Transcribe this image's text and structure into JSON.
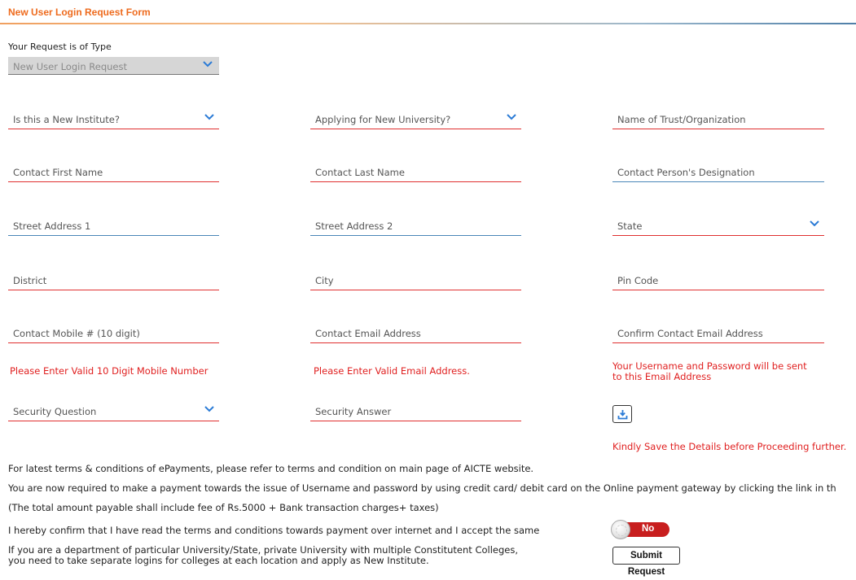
{
  "form": {
    "title": "New User Login Request Form",
    "request_type_label": "Your Request is of Type",
    "request_type_value": "New User Login Request"
  },
  "fields": {
    "new_institute": "Is this a New Institute?",
    "new_university": "Applying for New University?",
    "trust_name": "Name of Trust/Organization",
    "first_name": "Contact First Name",
    "last_name": "Contact Last Name",
    "designation": "Contact Person's Designation",
    "street1": "Street Address 1",
    "street2": "Street Address 2",
    "state": "State",
    "district": "District",
    "city": "City",
    "pin": "Pin Code",
    "mobile": "Contact Mobile # (10 digit)",
    "email": "Contact Email Address",
    "confirm_email": "Confirm Contact Email Address",
    "security_question": "Security Question",
    "security_answer": "Security Answer"
  },
  "messages": {
    "mobile_error": "Please Enter Valid 10 Digit Mobile Number",
    "email_error": "Please Enter Valid Email Address.",
    "confirm_email_note_1": "Your Username and Password will be sent",
    "confirm_email_note_2": "to this Email Address",
    "save_note": "Kindly Save the Details before Proceeding further."
  },
  "info": {
    "terms": "For latest terms & conditions of ePayments, please refer to terms and condition on main page of AICTE website.",
    "payment": "You are now required to make a payment towards the issue of Username and password by using credit card/ debit card on the Online payment gateway by clicking the link in th",
    "fee": "(The total amount payable shall include fee of Rs.5000 + Bank transaction charges+ taxes)",
    "confirm": "I hereby confirm that I have read the terms and conditions towards payment over internet and I accept the same",
    "dept_note_1": "If you are a department of particular University/State, private University with multiple Constitutent Colleges,",
    "dept_note_2": "you need to take separate logins for colleges at each location and apply as New Institute."
  },
  "controls": {
    "toggle_label": "No",
    "submit_label": "Submit Request",
    "save_icon": "save-icon",
    "chevron_icon": "chevron-down-icon"
  },
  "colors": {
    "title": "#ee6b1e",
    "error": "#e02020",
    "accent_blue": "#2b7bd6",
    "toggle_off": "#c81e1e"
  }
}
